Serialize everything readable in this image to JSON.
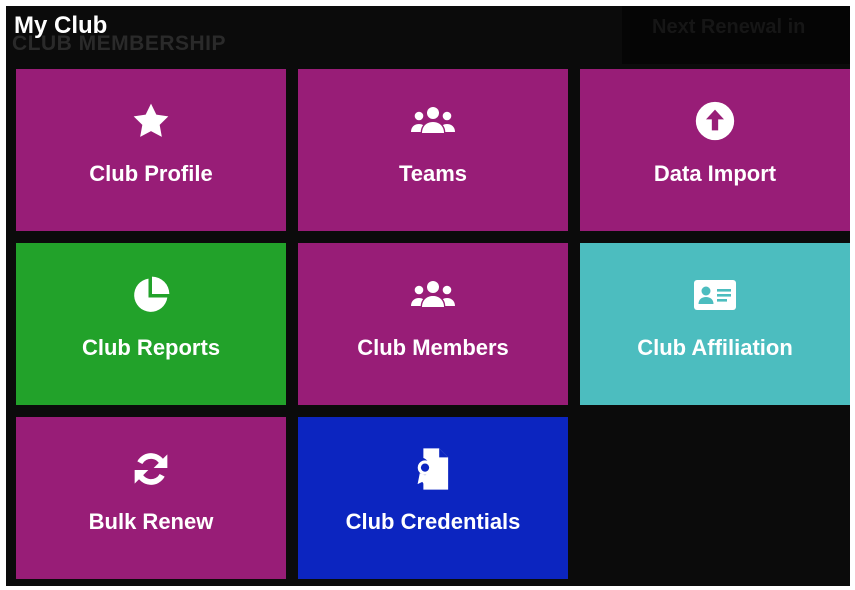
{
  "header": {
    "title": "My Club",
    "ghost_left": "CLUB MEMBERSHIP",
    "ghost_right": "Next Renewal in"
  },
  "tiles": [
    {
      "label": "Club Profile",
      "icon": "star-icon"
    },
    {
      "label": "Teams",
      "icon": "users-icon"
    },
    {
      "label": "Data Import",
      "icon": "upload-circle-icon"
    },
    {
      "label": "Club Reports",
      "icon": "pie-chart-icon"
    },
    {
      "label": "Club Members",
      "icon": "users-icon"
    },
    {
      "label": "Club Affiliation",
      "icon": "id-card-icon"
    },
    {
      "label": "Bulk Renew",
      "icon": "sync-icon"
    },
    {
      "label": "Club Credentials",
      "icon": "file-certificate-icon"
    }
  ],
  "colors": {
    "panel_bg": "#0b0b0b",
    "magenta": "#981d77",
    "green": "#22a22a",
    "teal": "#4cbdbf",
    "blue": "#0c25c0",
    "text": "#ffffff"
  }
}
